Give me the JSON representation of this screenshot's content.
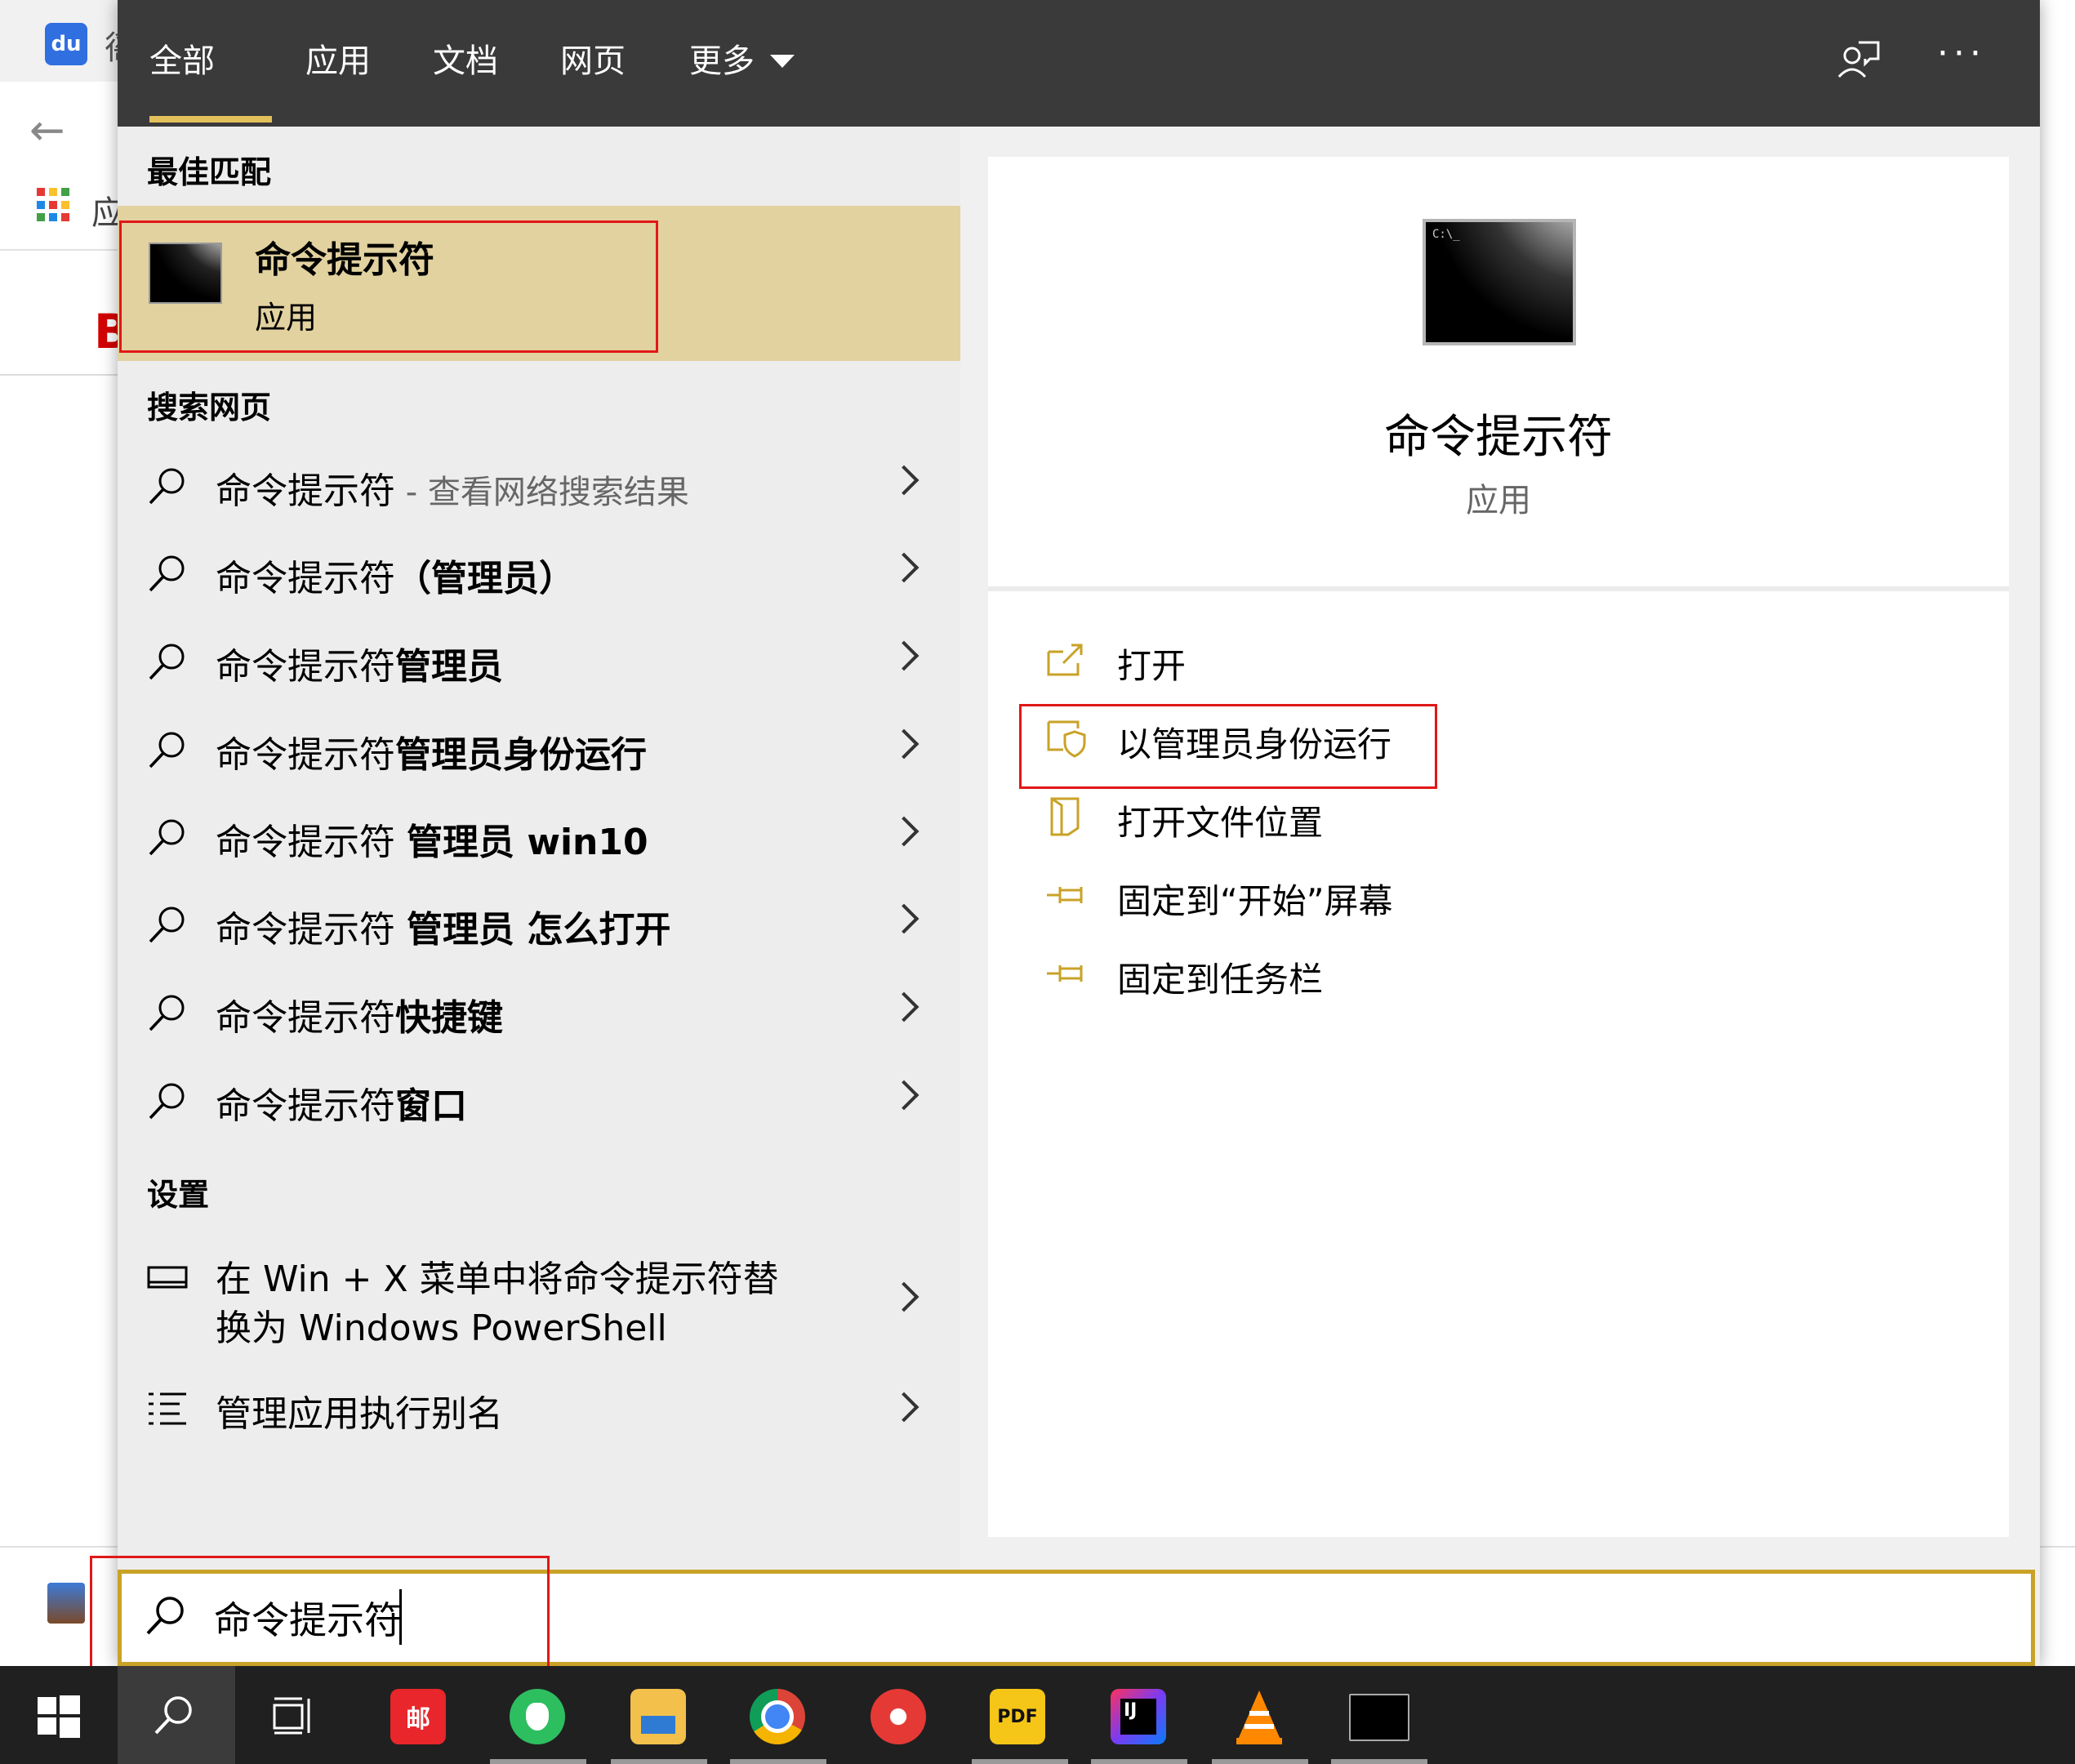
{
  "background": {
    "tab_char": "徭",
    "app_char": "应",
    "red_letter": "B"
  },
  "nav": {
    "tabs": [
      "全部",
      "应用",
      "文档",
      "网页",
      "更多"
    ],
    "active_tab": "全部",
    "more_icon": "caret-down-icon",
    "feedback_icon": "feedback-icon",
    "overflow_label": "···"
  },
  "best_match": {
    "section": "最佳匹配",
    "title": "命令提示符",
    "subtitle": "应用"
  },
  "web": {
    "section": "搜索网页",
    "items": [
      {
        "prefix": "命令提示符",
        "suffix": "",
        "note": " - 查看网络搜索结果"
      },
      {
        "prefix": "命令提示符",
        "suffix": "（管理员）",
        "note": ""
      },
      {
        "prefix": "命令提示符",
        "suffix": "管理员",
        "note": ""
      },
      {
        "prefix": "命令提示符",
        "suffix": "管理员身份运行",
        "note": ""
      },
      {
        "prefix": "命令提示符 ",
        "suffix": "管理员 win10",
        "note": ""
      },
      {
        "prefix": "命令提示符 ",
        "suffix": "管理员 怎么打开",
        "note": ""
      },
      {
        "prefix": "命令提示符",
        "suffix": "快捷键",
        "note": ""
      },
      {
        "prefix": "命令提示符",
        "suffix": "窗口",
        "note": ""
      }
    ]
  },
  "settings": {
    "section": "设置",
    "item1_line1": "在 Win + X 菜单中将命令提示符替",
    "item1_line2": "换为 Windows PowerShell",
    "item2": "管理应用执行别名"
  },
  "detail": {
    "prompt_glyph": "C:\\_",
    "title": "命令提示符",
    "subtitle": "应用",
    "actions": [
      {
        "label": "打开",
        "icon": "open-icon"
      },
      {
        "label": "以管理员身份运行",
        "icon": "shield-icon"
      },
      {
        "label": "打开文件位置",
        "icon": "folder-location-icon"
      },
      {
        "label": "固定到“开始”屏幕",
        "icon": "pin-icon"
      },
      {
        "label": "固定到任务栏",
        "icon": "pin-icon"
      }
    ]
  },
  "search": {
    "query": "命令提示符"
  },
  "taskbar": {
    "apps": [
      {
        "name": "start",
        "label": ""
      },
      {
        "name": "search",
        "label": ""
      },
      {
        "name": "task-view",
        "label": ""
      },
      {
        "name": "mail-app",
        "label": "邮"
      },
      {
        "name": "evernote",
        "label": ""
      },
      {
        "name": "file-explorer",
        "label": ""
      },
      {
        "name": "chrome",
        "label": ""
      },
      {
        "name": "snail-app",
        "label": ""
      },
      {
        "name": "pdf-app",
        "label": "PDF"
      },
      {
        "name": "intellij",
        "label": "IJ"
      },
      {
        "name": "vlc",
        "label": ""
      },
      {
        "name": "cmd",
        "label": ""
      }
    ]
  },
  "colors": {
    "accent": "#e4c05a",
    "highlight": "#e2d2a0",
    "annotation_red": "#e01818",
    "nav_bg": "#3a3a3a",
    "action_icon": "#c9a227"
  }
}
